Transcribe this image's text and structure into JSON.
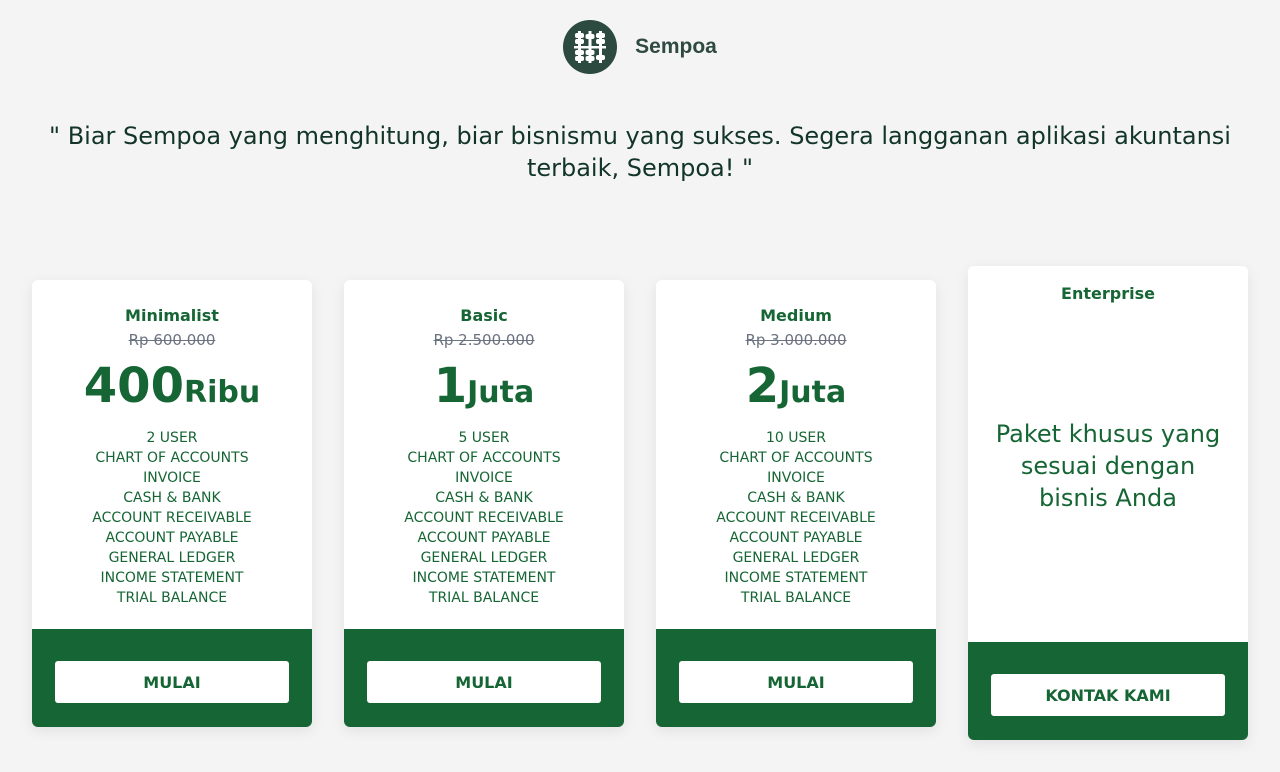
{
  "brand": {
    "name": "Sempoa",
    "logo_icon": "abacus-icon"
  },
  "tagline": "\" Biar Sempoa yang menghitung, biar bisnismu yang sukses. Segera langganan aplikasi akuntansi terbaik, Sempoa! \"",
  "plans": [
    {
      "name": "Minimalist",
      "old_price": "Rp 600.000",
      "price_number": "400",
      "price_unit": "Ribu",
      "features": [
        "2 USER",
        "CHART OF ACCOUNTS",
        "INVOICE",
        "CASH & BANK",
        "ACCOUNT RECEIVABLE",
        "ACCOUNT PAYABLE",
        "GENERAL LEDGER",
        "INCOME STATEMENT",
        "TRIAL BALANCE"
      ],
      "cta": "MULAI"
    },
    {
      "name": "Basic",
      "old_price": "Rp 2.500.000",
      "price_number": "1",
      "price_unit": "Juta",
      "features": [
        "5 USER",
        "CHART OF ACCOUNTS",
        "INVOICE",
        "CASH & BANK",
        "ACCOUNT RECEIVABLE",
        "ACCOUNT PAYABLE",
        "GENERAL LEDGER",
        "INCOME STATEMENT",
        "TRIAL BALANCE"
      ],
      "cta": "MULAI"
    },
    {
      "name": "Medium",
      "old_price": "Rp 3.000.000",
      "price_number": "2",
      "price_unit": "Juta",
      "features": [
        "10 USER",
        "CHART OF ACCOUNTS",
        "INVOICE",
        "CASH & BANK",
        "ACCOUNT RECEIVABLE",
        "ACCOUNT PAYABLE",
        "GENERAL LEDGER",
        "INCOME STATEMENT",
        "TRIAL BALANCE"
      ],
      "cta": "MULAI"
    }
  ],
  "enterprise": {
    "name": "Enterprise",
    "description": "Paket khusus yang sesuai dengan bisnis Anda",
    "cta": "KONTAK KAMI"
  },
  "colors": {
    "primary": "#166534",
    "background": "#f4f4f4",
    "logo": "#2c4a40"
  }
}
